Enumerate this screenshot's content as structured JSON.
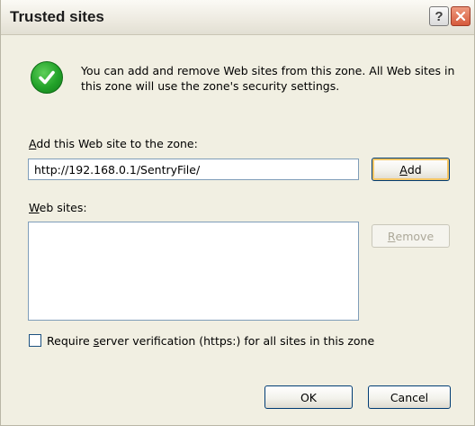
{
  "window": {
    "title": "Trusted sites"
  },
  "titlebar": {
    "help_label": "?",
    "close_label": "✕"
  },
  "info": {
    "icon": "checkmark-icon",
    "message": "You can add and remove Web sites from this zone. All Web sites in this zone will use the zone's security settings."
  },
  "add_site": {
    "label_mnemonic": "A",
    "label_rest": "dd this Web site to the zone:",
    "url_value": "http://192.168.0.1/SentryFile/",
    "add_button_mnemonic": "A",
    "add_button_rest": "dd"
  },
  "web_sites": {
    "label_mnemonic": "W",
    "label_rest": "eb sites:",
    "items": [],
    "remove_button_mnemonic": "R",
    "remove_button_rest": "emove"
  },
  "verification": {
    "checked": false,
    "label_before": "Require ",
    "label_mnemonic": "s",
    "label_after": "erver verification (https:) for all sites in this zone"
  },
  "footer": {
    "ok_label": "OK",
    "cancel_label": "Cancel"
  },
  "colors": {
    "dialog_background": "#f1efe2",
    "button_border": "#003c74",
    "checkmark_green": "#22a229",
    "close_button": "#d65a3c"
  }
}
